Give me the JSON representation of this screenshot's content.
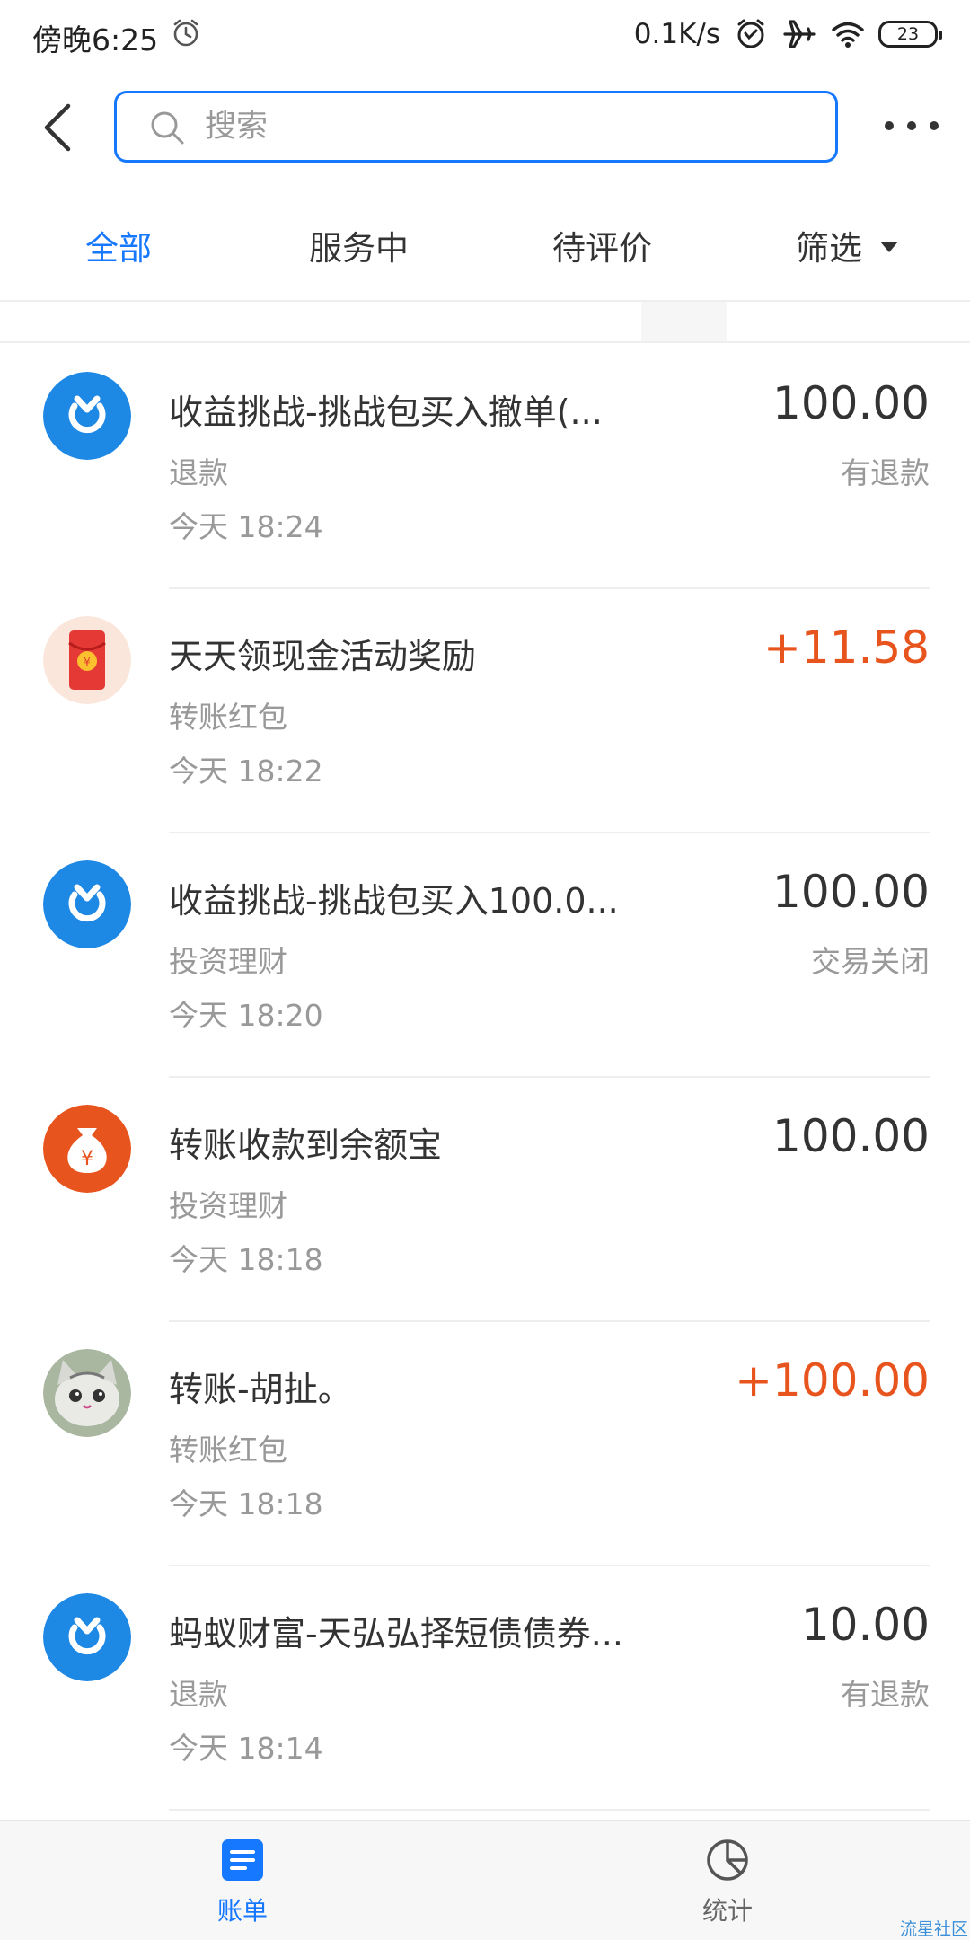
{
  "status_bar": {
    "time": "傍晚6:25",
    "net_speed": "0.1K/s",
    "battery": "23"
  },
  "header": {
    "search_placeholder": "搜索"
  },
  "tabs": [
    {
      "label": "全部",
      "active": true
    },
    {
      "label": "服务中",
      "active": false
    },
    {
      "label": "待评价",
      "active": false
    },
    {
      "label": "筛选",
      "active": false
    }
  ],
  "transactions": [
    {
      "icon": "ant-fortune-icon",
      "title": "收益挑战-挑战包买入撤单(...",
      "category": "退款",
      "time": "今天  18:24",
      "amount": "100.00",
      "status": "有退款",
      "amount_color": "#333333"
    },
    {
      "icon": "red-envelope-icon",
      "title": "天天领现金活动奖励",
      "category": "转账红包",
      "time": "今天  18:22",
      "amount": "+11.58",
      "status": "",
      "amount_color": "#e8541e"
    },
    {
      "icon": "ant-fortune-icon",
      "title": "收益挑战-挑战包买入100.0...",
      "category": "投资理财",
      "time": "今天  18:20",
      "amount": "100.00",
      "status": "交易关闭",
      "amount_color": "#333333"
    },
    {
      "icon": "money-bag-icon",
      "title": "转账收款到余额宝",
      "category": "投资理财",
      "time": "今天  18:18",
      "amount": "100.00",
      "status": "",
      "amount_color": "#333333"
    },
    {
      "icon": "cat-avatar-icon",
      "title": "转账-胡扯。",
      "category": "转账红包",
      "time": "今天  18:18",
      "amount": "+100.00",
      "status": "",
      "amount_color": "#e8541e"
    },
    {
      "icon": "ant-fortune-icon",
      "title": "蚂蚁财富-天弘弘择短债债券...",
      "category": "退款",
      "time": "今天  18:14",
      "amount": "10.00",
      "status": "有退款",
      "amount_color": "#333333"
    }
  ],
  "bottom_nav": {
    "bills_label": "账单",
    "stats_label": "统计"
  },
  "watermark": "流星社区",
  "colors": {
    "accent": "#1677ff",
    "income": "#e8541e"
  }
}
